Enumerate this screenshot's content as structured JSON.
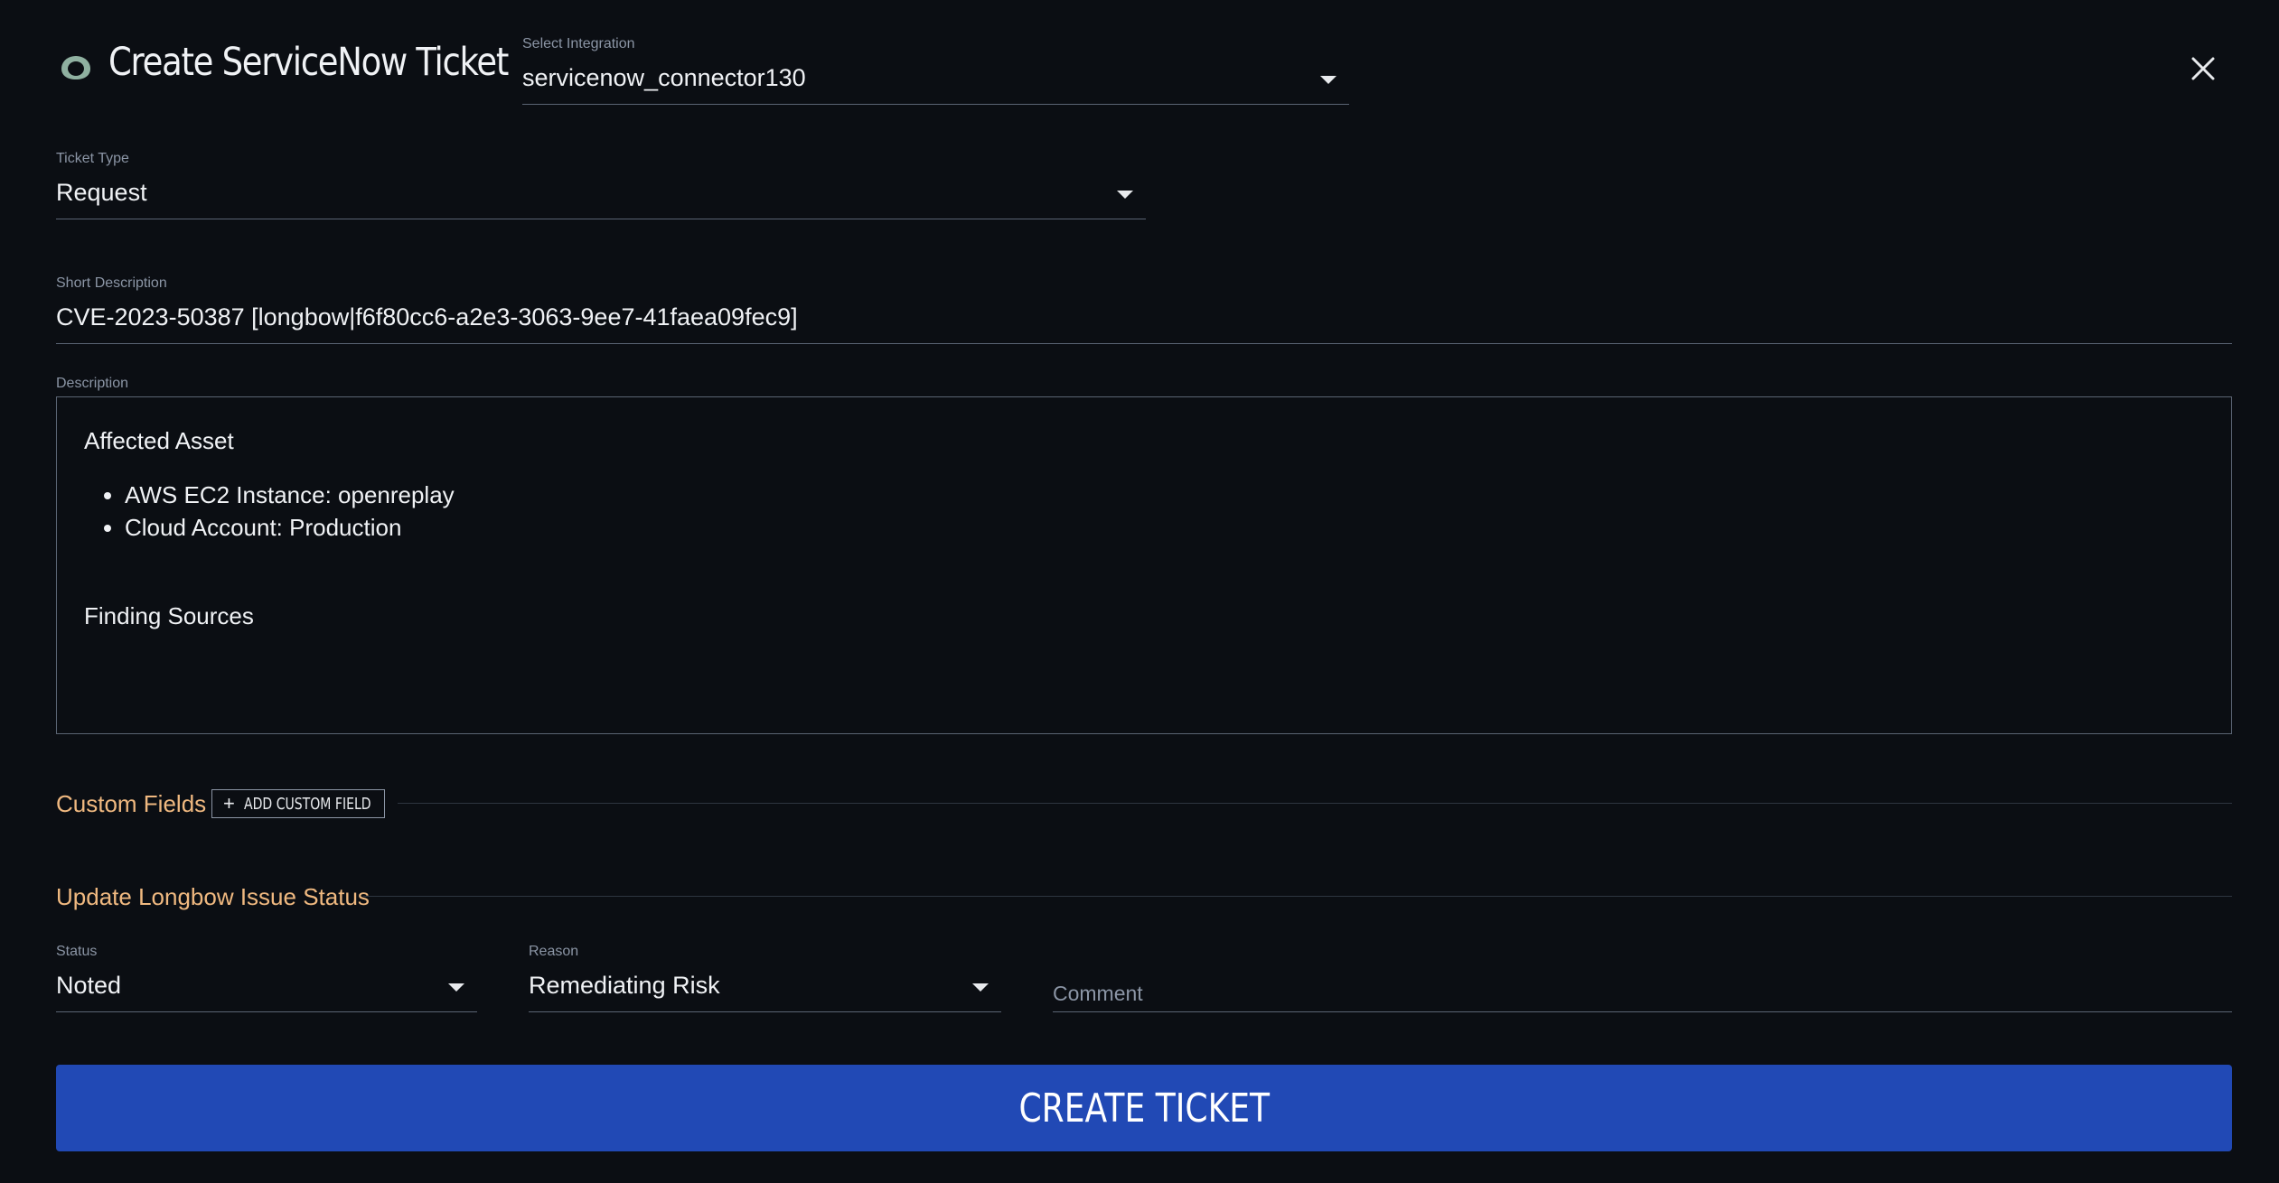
{
  "header": {
    "title": "Create ServiceNow Ticket",
    "logo_icon": "longbow-logo-icon",
    "close_icon": "close-icon"
  },
  "integration": {
    "label": "Select Integration",
    "value": "servicenow_connector130"
  },
  "ticket_type": {
    "label": "Ticket Type",
    "value": "Request"
  },
  "short_description": {
    "label": "Short Description",
    "value": "CVE-2023-50387 [longbow|f6f80cc6-a2e3-3063-9ee7-41faea09fec9]"
  },
  "description": {
    "label": "Description",
    "affected_heading": "Affected Asset",
    "items": [
      "AWS EC2 Instance: openreplay",
      "Cloud Account: Production"
    ],
    "sources_heading": "Finding Sources"
  },
  "custom_fields": {
    "title": "Custom Fields",
    "add_button": "ADD CUSTOM FIELD"
  },
  "update_status": {
    "title": "Update Longbow Issue Status",
    "status_label": "Status",
    "status_value": "Noted",
    "reason_label": "Reason",
    "reason_value": "Remediating Risk",
    "comment_placeholder": "Comment"
  },
  "actions": {
    "create_label": "CREATE TICKET"
  },
  "colors": {
    "background": "#0b0e13",
    "accent_orange": "#f0b980",
    "primary_button": "#2149b5",
    "logo_green": "#8fb0a0"
  }
}
